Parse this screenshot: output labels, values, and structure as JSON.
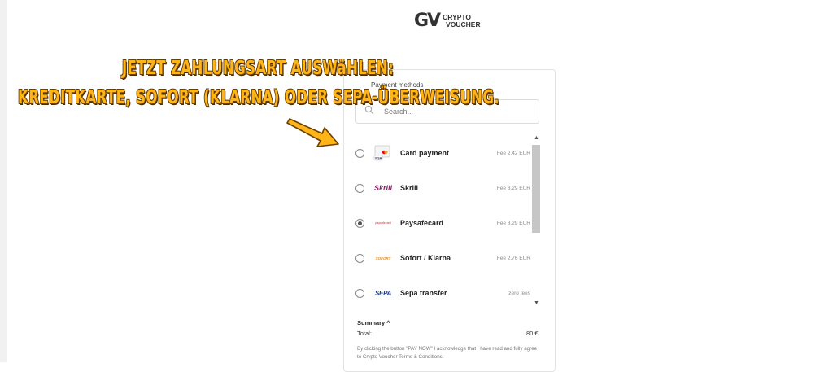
{
  "brand": {
    "mark": "GV",
    "name_line1": "CRYPTO",
    "name_line2": "VOUCHER"
  },
  "annotation": {
    "line1": "JETZT ZAHLUNGSART AUSWäHLEN:",
    "line2": "KREDITKARTE, SOFORT (KLARNA) ODER SEPA-ÜBERWEISUNG.",
    "color": "#ffb417",
    "arrow_icon": "arrow-pointing-right-down"
  },
  "payment": {
    "title": "Payment methods",
    "search_placeholder": "Search...",
    "methods": [
      {
        "label": "Card payment",
        "fee": "Fee 2.42 EUR",
        "icon": "card-icon",
        "selected": false
      },
      {
        "label": "Skrill",
        "fee": "Fee 8.29 EUR",
        "icon": "skrill-logo",
        "selected": false
      },
      {
        "label": "Paysafecard",
        "fee": "Fee 8.29 EUR",
        "icon": "paysafecard-logo",
        "selected": true
      },
      {
        "label": "Sofort / Klarna",
        "fee": "Fee 2.76 EUR",
        "icon": "sofort-logo",
        "selected": false
      },
      {
        "label": "Sepa transfer",
        "fee": "zero fees",
        "icon": "sepa-logo",
        "selected": false
      }
    ],
    "logo_text": {
      "skrill": "Skrill",
      "paysafecard": "paysafecard",
      "sofort": "SOFORT",
      "sepa": "SEPA",
      "visa": "VISA"
    }
  },
  "summary": {
    "label": "Summary ^",
    "total_label": "Total:",
    "total_value": "80 €",
    "agreement": "By clicking the button \"PAY NOW\" I acknowledge that I have read and fully agree to Crypto Voucher Terms & Conditions."
  },
  "colors": {
    "skrill": "#862165",
    "paysafe": "#d32f2f",
    "sofort": "#ef8a17",
    "sepa_blue": "#1a3b8c",
    "sepa_yellow": "#ffcc00"
  }
}
